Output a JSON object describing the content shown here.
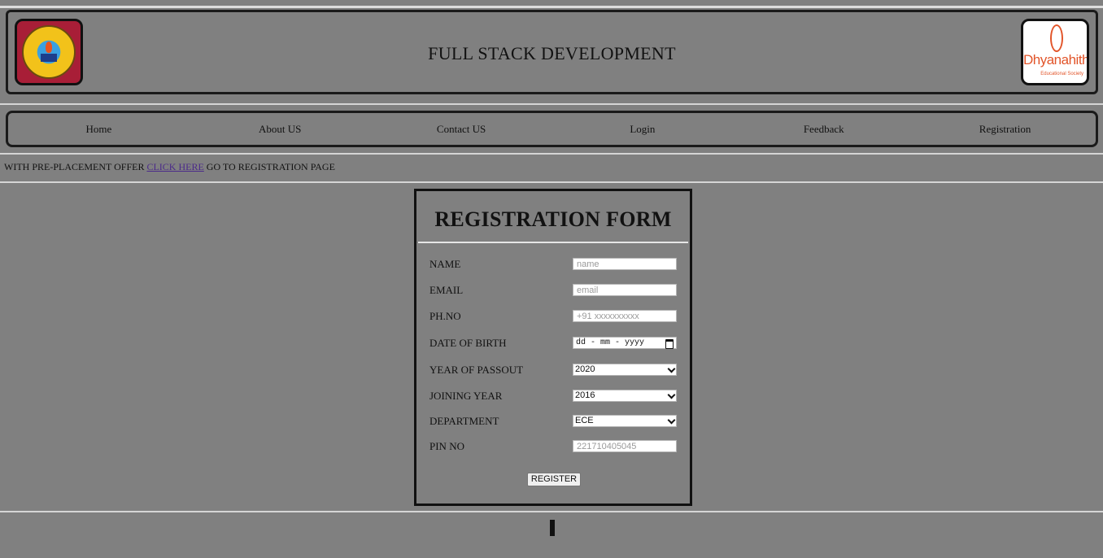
{
  "header": {
    "title": "FULL STACK DEVELOPMENT",
    "left_logo": "gitam-logo",
    "right_logo": {
      "name": "dhyanahitha-logo",
      "text": "Dhyanahitha",
      "subtext": "Educational Society"
    }
  },
  "nav": {
    "items": [
      {
        "label": "Home"
      },
      {
        "label": "About US"
      },
      {
        "label": "Contact US"
      },
      {
        "label": "Login"
      },
      {
        "label": "Feedback"
      },
      {
        "label": "Registration"
      }
    ]
  },
  "promo": {
    "prefix": "WITH PRE-PLACEMENT OFFER ",
    "link": "CLICK HERE",
    "suffix": " GO TO REGISTRATION PAGE"
  },
  "form": {
    "title": "REGISTRATION FORM",
    "fields": {
      "name": {
        "label": "NAME",
        "placeholder": "name"
      },
      "email": {
        "label": "EMAIL",
        "placeholder": "email"
      },
      "phone": {
        "label": "PH.NO",
        "placeholder": "+91 xxxxxxxxxx"
      },
      "dob": {
        "label": "DATE OF BIRTH",
        "value": "dd - mm - yyyy"
      },
      "passout": {
        "label": "YEAR OF PASSOUT",
        "value": "2020"
      },
      "joining": {
        "label": "JOINING YEAR",
        "value": "2016"
      },
      "department": {
        "label": "DEPARTMENT",
        "value": "ECE"
      },
      "pin": {
        "label": "PIN NO",
        "placeholder": "221710405045"
      }
    },
    "submit_label": "REGISTER"
  },
  "colors": {
    "background": "#808080",
    "border": "#1a1a1a",
    "link": "#4b2a8a",
    "brand_orange": "#e2552a",
    "gitam_red": "#a81e37"
  }
}
